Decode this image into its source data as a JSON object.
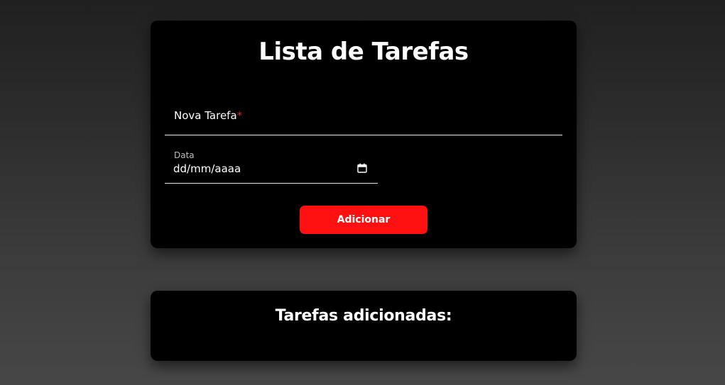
{
  "form": {
    "title": "Lista de Tarefas",
    "task_label": "Nova Tarefa",
    "required_mark": "*",
    "date_label": "Data",
    "date_placeholder": "dd/mm/aaaa",
    "calendar_icon": "calendar-icon",
    "add_button_label": "Adicionar"
  },
  "list": {
    "title": "Tarefas adicionadas:",
    "items": []
  },
  "colors": {
    "accent": "#ff1010",
    "card_background": "#000000",
    "required": "#e81c1c"
  }
}
